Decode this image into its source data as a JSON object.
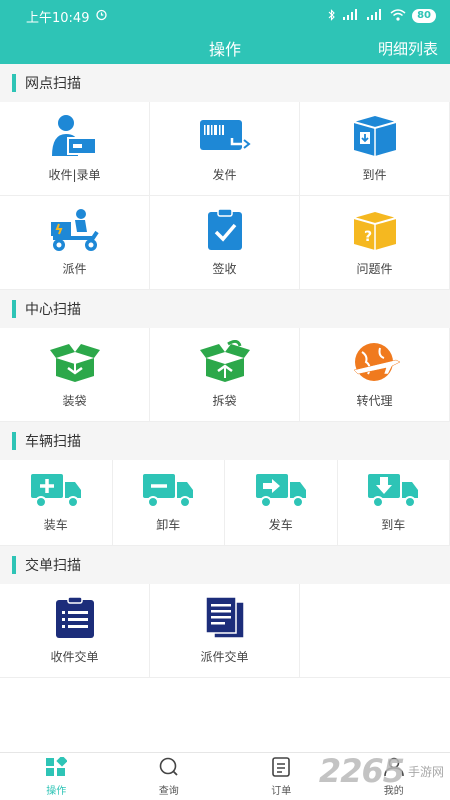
{
  "status_bar": {
    "time": "上午10:49",
    "battery": "80"
  },
  "header": {
    "title": "操作",
    "detail_link": "明细列表"
  },
  "sections": {
    "outlet": {
      "title": "网点扫描",
      "items": [
        {
          "label": "收件|录单",
          "icon": "courier-package-icon"
        },
        {
          "label": "发件",
          "icon": "send-card-icon"
        },
        {
          "label": "到件",
          "icon": "arrival-box-icon"
        },
        {
          "label": "派件",
          "icon": "delivery-scooter-icon"
        },
        {
          "label": "签收",
          "icon": "sign-clipboard-icon"
        },
        {
          "label": "问题件",
          "icon": "problem-box-icon"
        }
      ]
    },
    "center": {
      "title": "中心扫描",
      "items": [
        {
          "label": "装袋",
          "icon": "pack-box-icon"
        },
        {
          "label": "拆袋",
          "icon": "unpack-box-icon"
        },
        {
          "label": "转代理",
          "icon": "globe-plane-icon"
        }
      ]
    },
    "vehicle": {
      "title": "车辆扫描",
      "items": [
        {
          "label": "装车",
          "icon": "truck-plus-icon"
        },
        {
          "label": "卸车",
          "icon": "truck-minus-icon"
        },
        {
          "label": "发车",
          "icon": "truck-depart-icon"
        },
        {
          "label": "到车",
          "icon": "truck-arrive-icon"
        }
      ]
    },
    "handover": {
      "title": "交单扫描",
      "items": [
        {
          "label": "收件交单",
          "icon": "receive-list-icon"
        },
        {
          "label": "派件交单",
          "icon": "dispatch-docs-icon"
        }
      ]
    }
  },
  "tabbar": [
    {
      "label": "操作",
      "icon": "grid-icon",
      "active": true
    },
    {
      "label": "查询",
      "icon": "search-icon",
      "active": false
    },
    {
      "label": "订单",
      "icon": "order-icon",
      "active": false
    },
    {
      "label": "我的",
      "icon": "profile-icon",
      "active": false
    }
  ],
  "watermark": {
    "number": "2265",
    "text": "手游网"
  },
  "colors": {
    "accent": "#2ec4b6",
    "blue": "#1e88d6",
    "green": "#2ca84a",
    "orange": "#f07a1e",
    "yellow": "#f5b820",
    "navy": "#1c2d7a"
  }
}
